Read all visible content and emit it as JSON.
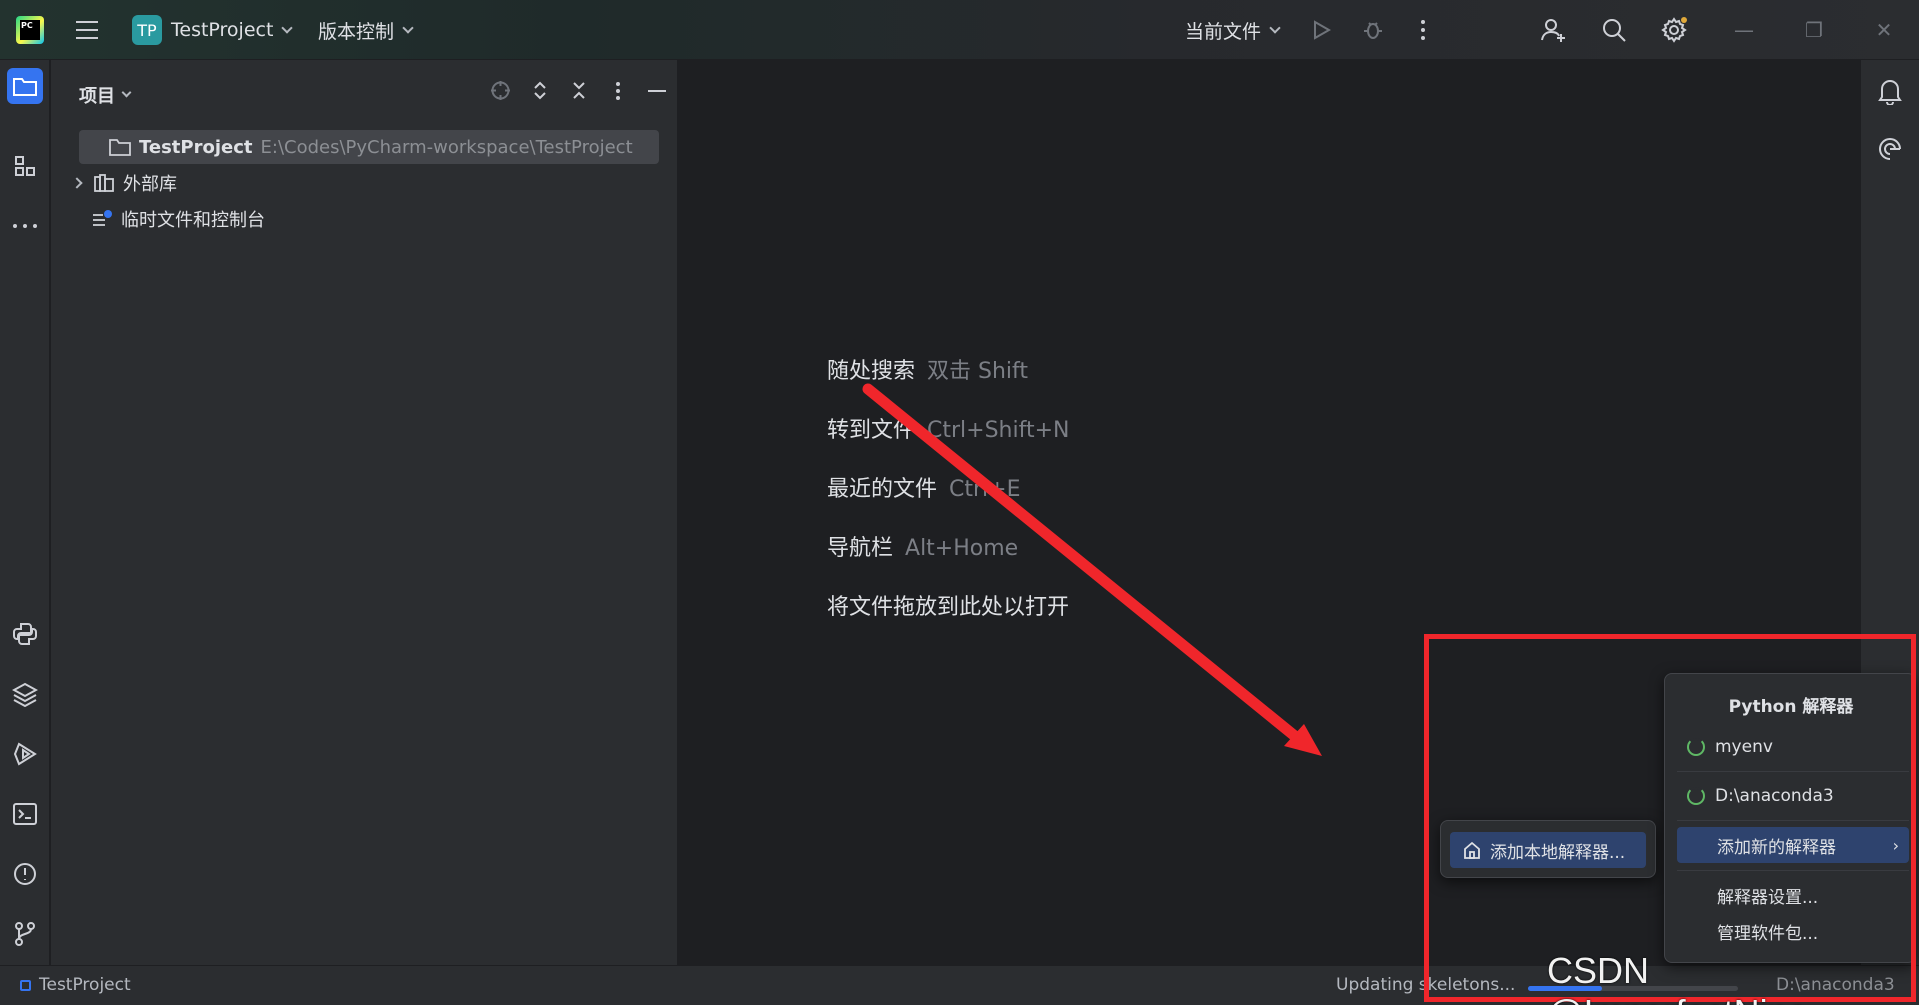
{
  "titlebar": {
    "project_badge": "TP",
    "project_name": "TestProject",
    "vcs_label": "版本控制",
    "run_config": "当前文件"
  },
  "project_panel": {
    "title": "项目",
    "tree": [
      {
        "label": "TestProject",
        "path": "E:\\Codes\\PyCharm-workspace\\TestProject"
      },
      {
        "label": "外部库"
      },
      {
        "label": "临时文件和控制台"
      }
    ]
  },
  "editor": {
    "hints": [
      {
        "action": "随处搜索",
        "key": "双击 Shift"
      },
      {
        "action": "转到文件",
        "key": "Ctrl+Shift+N"
      },
      {
        "action": "最近的文件",
        "key": "Ctrl+E"
      },
      {
        "action": "导航栏",
        "key": "Alt+Home"
      },
      {
        "action": "将文件拖放到此处以打开",
        "key": ""
      }
    ]
  },
  "interpreter_popup": {
    "title": "Python 解释器",
    "interpreters": [
      "myenv",
      "D:\\anaconda3"
    ],
    "add_new": "添加新的解释器",
    "settings": "解释器设置...",
    "manage_packages": "管理软件包...",
    "submenu_add_local": "添加本地解释器..."
  },
  "statusbar": {
    "project": "TestProject",
    "progress_text": "Updating skeletons...",
    "progress_fraction": 0.35,
    "interpreter": "D:\\anaconda3"
  },
  "watermark": "CSDN @ImperfectNine",
  "colors": {
    "accent": "#3574f0",
    "annotation_red": "#f0262b",
    "popup_highlight": "#2e436e"
  }
}
